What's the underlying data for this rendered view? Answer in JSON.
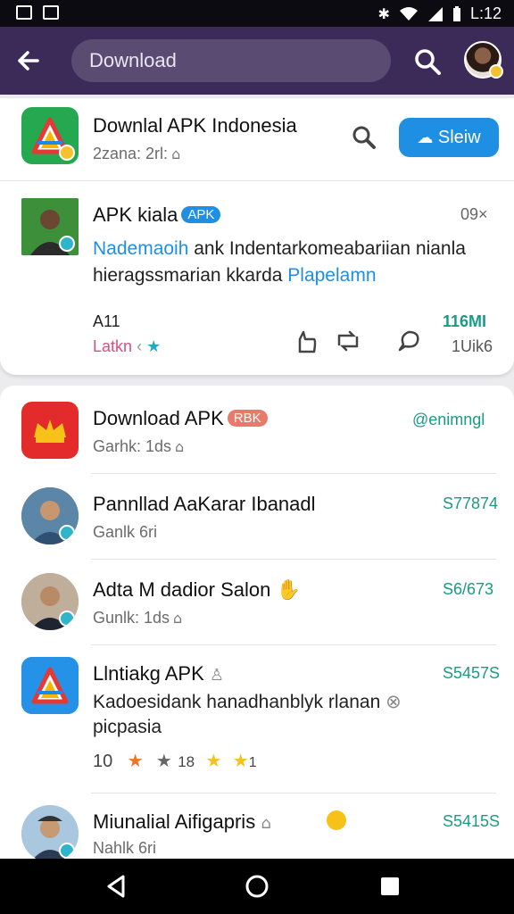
{
  "status": {
    "time": "L:12"
  },
  "topbar": {
    "search_text": "Download"
  },
  "header_app": {
    "title": "Downlal APK Indonesia",
    "subtitle": "2zana: 2rl:",
    "button_label": "Sleiw"
  },
  "post": {
    "title": "APK kiala",
    "tag": "APK",
    "close_label": "09×",
    "body_line1_accent": "Nademaoih",
    "body_line1": " ank Indentarkomeabariian nianla",
    "body_line2": "hieragssmarian kkarda ",
    "body_line2_accent": "Plapelamn",
    "count_left": "A11",
    "label_left": "Latkn",
    "size_value": "116MI",
    "version_value": "1Uik6"
  },
  "list": [
    {
      "title": "Download APK",
      "tag": "RBK",
      "subtitle": "Garhk: 1ds",
      "right": "@enimngl"
    },
    {
      "title": "Pannllad AaKarar Ibanadl",
      "subtitle": "Ganlk  6ri",
      "right": "S77874"
    },
    {
      "title": "Adta M dadior Salon",
      "subtitle": "Gunlk: 1ds",
      "right": "S6/673"
    },
    {
      "title": "Llntiakg APK",
      "line1": "Kadoesidank hanadhanblyk rlanan",
      "line2": "picpasia",
      "rating": "10",
      "rating2": "18",
      "rating3": "1",
      "right": "S5457S"
    },
    {
      "title": "Miunalial Aifigapris",
      "subtitle": "Nahlk  6ri",
      "right": "S5415S"
    }
  ],
  "colors": {
    "appbar": "#3c2b58",
    "accent_blue": "#1e8fe3",
    "accent_green": "#1a9b85",
    "pink": "#d94f7c"
  }
}
